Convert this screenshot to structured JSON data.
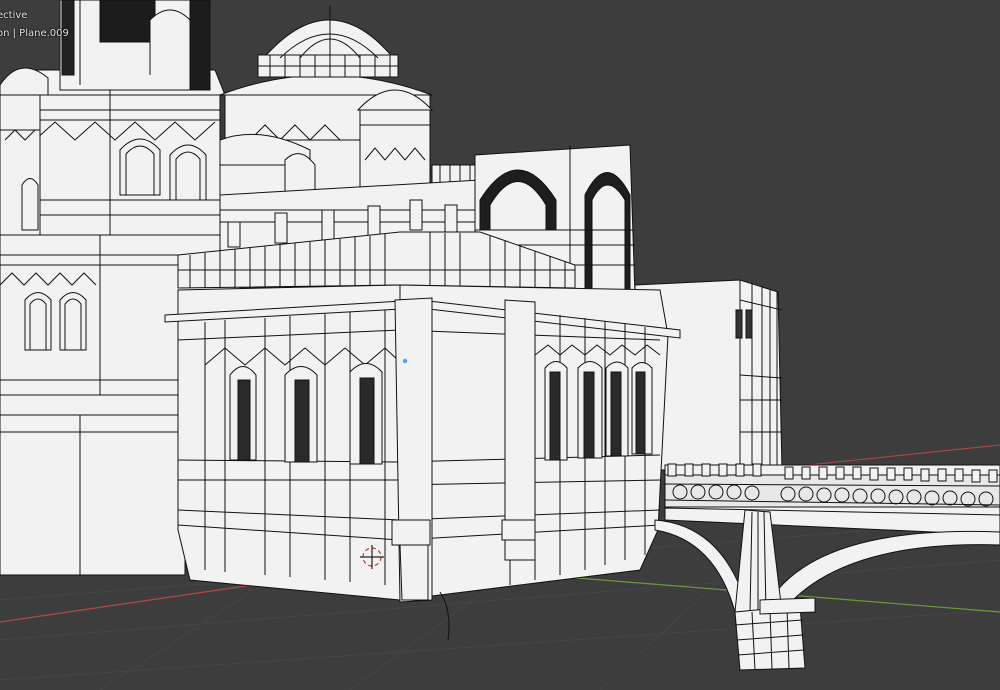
{
  "viewport": {
    "view_mode_text": "ective",
    "object_info_text": "on | Plane.009",
    "background_color": "#3d3d3d",
    "model_fill_color": "#f2f2f2",
    "wire_color": "#111111",
    "grid_x_axis_color": "#b34747",
    "grid_y_axis_color": "#6b9a3a",
    "origin_marker_color": "#4aa3ff"
  },
  "scene": {
    "description_icons": [
      "3d-cursor-icon",
      "object-origin-icon"
    ]
  }
}
